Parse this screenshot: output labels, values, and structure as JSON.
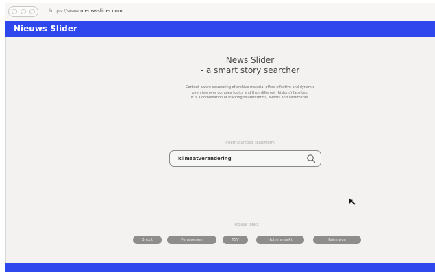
{
  "browser": {
    "url_prefix": "https://www.",
    "url_host": "nieuwsslider.com"
  },
  "header": {
    "title": "Nieuws Slider"
  },
  "hero": {
    "title": "News Slider",
    "subtitle": "- a smart story searcher",
    "description": [
      "Content-aware structuring of archive material offers effective and dynamic",
      "overview over complex topics and their different (historic) facettes.",
      "It is a combination of tracking related terms, events and sentiments."
    ]
  },
  "search": {
    "hint": "Insert your topic searchterm",
    "value": "klimaatverandering",
    "icon": "search-icon"
  },
  "popular": {
    "label": "Popular topics",
    "topics": [
      "Brexit",
      "Pensioenen",
      "TSV",
      "Huizenmarkt",
      "Rohingya"
    ]
  },
  "colors": {
    "brand_blue": "#2e48ee",
    "background": "#f3f2f1",
    "chip_gray": "#8d8d8d"
  }
}
